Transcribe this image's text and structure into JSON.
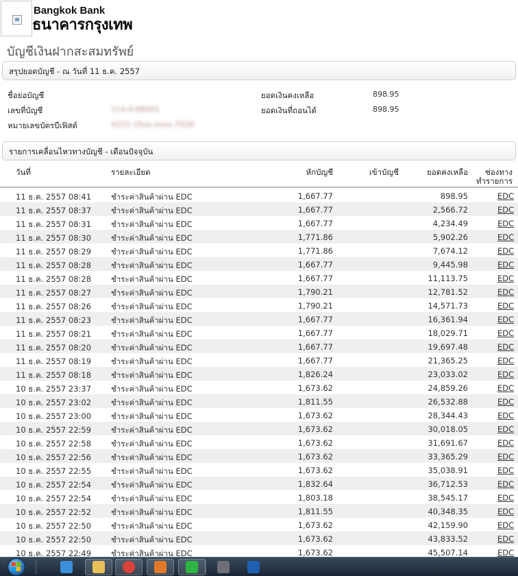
{
  "header": {
    "bank_name_en": "Bangkok Bank",
    "bank_name_th": "ธนาคารกรุงเทพ"
  },
  "page_title": "บัญชีเงินฝากสะสมทรัพย์",
  "summary": {
    "section_title": "สรุปยอดบัญชี - ณ วันที่ 11 ธ.ค. 2557",
    "account_name_label": "ชื่อย่อบัญชี",
    "account_number_label": "เลขที่บัญชี",
    "account_number_value": "114-0-88001",
    "debit_card_label": "หมายเลขบัตรบีเฟิสต์",
    "debit_card_value": "4215-15xx-xxxx-7028",
    "balance_label": "ยอดเงินคงเหลือ",
    "balance_value": "898.95",
    "available_label": "ยอดเงินที่ถอนได้",
    "available_value": "898.95"
  },
  "movements": {
    "section_title": "รายการเคลื่อนไหวทางบัญชี - เดือนปัจจุบัน",
    "columns": {
      "date": "วันที่",
      "desc": "รายละเอียด",
      "debit": "หักบัญชี",
      "credit": "เข้าบัญชี",
      "balance": "ยอดคงเหลือ",
      "channel_line1": "ช่องทาง",
      "channel_line2": "ทำรายการ"
    },
    "rows": [
      {
        "date": "11 ธ.ค. 2557 08:41",
        "desc": "ชำระค่าสินค้าผ่าน EDC",
        "debit": "1,667.77",
        "credit": "",
        "balance": "898.95",
        "channel": "EDC"
      },
      {
        "date": "11 ธ.ค. 2557 08:37",
        "desc": "ชำระค่าสินค้าผ่าน EDC",
        "debit": "1,667.77",
        "credit": "",
        "balance": "2,566.72",
        "channel": "EDC"
      },
      {
        "date": "11 ธ.ค. 2557 08:31",
        "desc": "ชำระค่าสินค้าผ่าน EDC",
        "debit": "1,667.77",
        "credit": "",
        "balance": "4,234.49",
        "channel": "EDC"
      },
      {
        "date": "11 ธ.ค. 2557 08:30",
        "desc": "ชำระค่าสินค้าผ่าน EDC",
        "debit": "1,771.86",
        "credit": "",
        "balance": "5,902.26",
        "channel": "EDC"
      },
      {
        "date": "11 ธ.ค. 2557 08:29",
        "desc": "ชำระค่าสินค้าผ่าน EDC",
        "debit": "1,771.86",
        "credit": "",
        "balance": "7,674.12",
        "channel": "EDC"
      },
      {
        "date": "11 ธ.ค. 2557 08:28",
        "desc": "ชำระค่าสินค้าผ่าน EDC",
        "debit": "1,667.77",
        "credit": "",
        "balance": "9,445.98",
        "channel": "EDC"
      },
      {
        "date": "11 ธ.ค. 2557 08:28",
        "desc": "ชำระค่าสินค้าผ่าน EDC",
        "debit": "1,667.77",
        "credit": "",
        "balance": "11,113.75",
        "channel": "EDC"
      },
      {
        "date": "11 ธ.ค. 2557 08:27",
        "desc": "ชำระค่าสินค้าผ่าน EDC",
        "debit": "1,790.21",
        "credit": "",
        "balance": "12,781.52",
        "channel": "EDC"
      },
      {
        "date": "11 ธ.ค. 2557 08:26",
        "desc": "ชำระค่าสินค้าผ่าน EDC",
        "debit": "1,790.21",
        "credit": "",
        "balance": "14,571.73",
        "channel": "EDC"
      },
      {
        "date": "11 ธ.ค. 2557 08:23",
        "desc": "ชำระค่าสินค้าผ่าน EDC",
        "debit": "1,667.77",
        "credit": "",
        "balance": "16,361.94",
        "channel": "EDC"
      },
      {
        "date": "11 ธ.ค. 2557 08:21",
        "desc": "ชำระค่าสินค้าผ่าน EDC",
        "debit": "1,667.77",
        "credit": "",
        "balance": "18,029.71",
        "channel": "EDC"
      },
      {
        "date": "11 ธ.ค. 2557 08:20",
        "desc": "ชำระค่าสินค้าผ่าน EDC",
        "debit": "1,667.77",
        "credit": "",
        "balance": "19,697.48",
        "channel": "EDC"
      },
      {
        "date": "11 ธ.ค. 2557 08:19",
        "desc": "ชำระค่าสินค้าผ่าน EDC",
        "debit": "1,667.77",
        "credit": "",
        "balance": "21,365.25",
        "channel": "EDC"
      },
      {
        "date": "11 ธ.ค. 2557 08:18",
        "desc": "ชำระค่าสินค้าผ่าน EDC",
        "debit": "1,826.24",
        "credit": "",
        "balance": "23,033.02",
        "channel": "EDC"
      },
      {
        "date": "10 ธ.ค. 2557 23:37",
        "desc": "ชำระค่าสินค้าผ่าน EDC",
        "debit": "1,673.62",
        "credit": "",
        "balance": "24,859.26",
        "channel": "EDC"
      },
      {
        "date": "10 ธ.ค. 2557 23:02",
        "desc": "ชำระค่าสินค้าผ่าน EDC",
        "debit": "1,811.55",
        "credit": "",
        "balance": "26,532.88",
        "channel": "EDC"
      },
      {
        "date": "10 ธ.ค. 2557 23:00",
        "desc": "ชำระค่าสินค้าผ่าน EDC",
        "debit": "1,673.62",
        "credit": "",
        "balance": "28,344.43",
        "channel": "EDC"
      },
      {
        "date": "10 ธ.ค. 2557 22:59",
        "desc": "ชำระค่าสินค้าผ่าน EDC",
        "debit": "1,673.62",
        "credit": "",
        "balance": "30,018.05",
        "channel": "EDC"
      },
      {
        "date": "10 ธ.ค. 2557 22:58",
        "desc": "ชำระค่าสินค้าผ่าน EDC",
        "debit": "1,673.62",
        "credit": "",
        "balance": "31,691.67",
        "channel": "EDC"
      },
      {
        "date": "10 ธ.ค. 2557 22:56",
        "desc": "ชำระค่าสินค้าผ่าน EDC",
        "debit": "1,673.62",
        "credit": "",
        "balance": "33,365.29",
        "channel": "EDC"
      },
      {
        "date": "10 ธ.ค. 2557 22:55",
        "desc": "ชำระค่าสินค้าผ่าน EDC",
        "debit": "1,673.62",
        "credit": "",
        "balance": "35,038.91",
        "channel": "EDC"
      },
      {
        "date": "10 ธ.ค. 2557 22:54",
        "desc": "ชำระค่าสินค้าผ่าน EDC",
        "debit": "1,832.64",
        "credit": "",
        "balance": "36,712.53",
        "channel": "EDC"
      },
      {
        "date": "10 ธ.ค. 2557 22:54",
        "desc": "ชำระค่าสินค้าผ่าน EDC",
        "debit": "1,803.18",
        "credit": "",
        "balance": "38,545.17",
        "channel": "EDC"
      },
      {
        "date": "10 ธ.ค. 2557 22:52",
        "desc": "ชำระค่าสินค้าผ่าน EDC",
        "debit": "1,811.55",
        "credit": "",
        "balance": "40,348.35",
        "channel": "EDC"
      },
      {
        "date": "10 ธ.ค. 2557 22:50",
        "desc": "ชำระค่าสินค้าผ่าน EDC",
        "debit": "1,673.62",
        "credit": "",
        "balance": "42,159.90",
        "channel": "EDC"
      },
      {
        "date": "10 ธ.ค. 2557 22:50",
        "desc": "ชำระค่าสินค้าผ่าน EDC",
        "debit": "1,673.62",
        "credit": "",
        "balance": "43,833.52",
        "channel": "EDC"
      },
      {
        "date": "10 ธ.ค. 2557 22:49",
        "desc": "ชำระค่าสินค้าผ่าน EDC",
        "debit": "1,673.62",
        "credit": "",
        "balance": "45,507.14",
        "channel": "EDC"
      }
    ]
  },
  "taskbar": {
    "icons": [
      {
        "name": "internet-explorer-icon",
        "color": "#3b8fd9"
      },
      {
        "name": "file-explorer-icon",
        "color": "#e8c15a"
      },
      {
        "name": "chrome-icon",
        "color": "#d9423a"
      },
      {
        "name": "presentation-app-icon",
        "color": "#e07a2a"
      },
      {
        "name": "line-chat-icon",
        "color": "#2fb344"
      },
      {
        "name": "camera-app-icon",
        "color": "#6f6f7a"
      },
      {
        "name": "photoshop-icon",
        "color": "#1f5fb0"
      }
    ]
  }
}
